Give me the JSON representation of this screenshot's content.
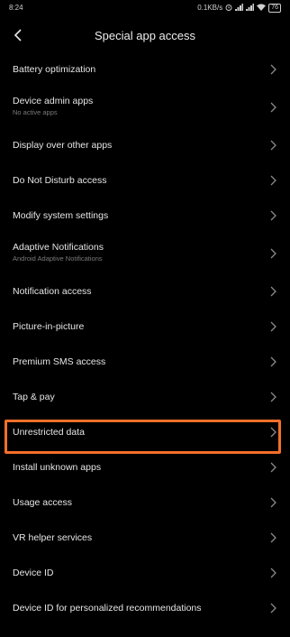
{
  "status_bar": {
    "time": "8:24",
    "speed": "0.1KB/s",
    "battery": "76",
    "icons": [
      "alarm-icon",
      "signal-icon",
      "signal-icon",
      "wifi-icon",
      "battery-icon"
    ]
  },
  "header": {
    "title": "Special app access",
    "back_icon": "chevron-left-icon"
  },
  "items": [
    {
      "label": "Battery optimization"
    },
    {
      "label": "Device admin apps",
      "sub": "No active apps"
    },
    {
      "label": "Display over other apps"
    },
    {
      "label": "Do Not Disturb access"
    },
    {
      "label": "Modify system settings"
    },
    {
      "label": "Adaptive Notifications",
      "sub": "Android Adaptive Notifications"
    },
    {
      "label": "Notification access"
    },
    {
      "label": "Picture-in-picture"
    },
    {
      "label": "Premium SMS access"
    },
    {
      "label": "Tap & pay"
    },
    {
      "label": "Unrestricted data"
    },
    {
      "label": "Install unknown apps"
    },
    {
      "label": "Usage access"
    },
    {
      "label": "VR helper services"
    },
    {
      "label": "Device ID"
    },
    {
      "label": "Device ID for personalized recommendations"
    }
  ],
  "colors": {
    "background": "#000000",
    "highlight": "#f36f2a",
    "text": "#e6e6e6",
    "subtext": "#7a7a7a"
  }
}
